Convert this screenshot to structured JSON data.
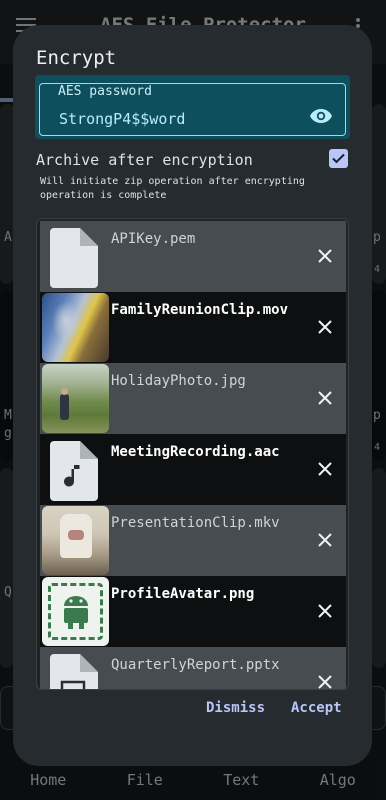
{
  "background": {
    "app_title": "AES File Protector",
    "edge_labels": [
      "A",
      "M",
      "g",
      "Q",
      "p",
      "4",
      "p",
      "4"
    ],
    "nav": [
      "Home",
      "File",
      "Text",
      "Algo"
    ]
  },
  "dialog": {
    "title": "Encrypt",
    "password": {
      "label": "AES password",
      "value": "StrongP4$$word"
    },
    "archive": {
      "label": "Archive after encryption",
      "checked": true,
      "hint": "Will initiate zip operation after encrypting operation is complete"
    },
    "files": [
      {
        "name": "APIKey.pem",
        "thumb": "doc-icon",
        "dark": false
      },
      {
        "name": "FamilyReunionClip.mov",
        "thumb": "video-thumbnail",
        "dark": true
      },
      {
        "name": "HolidayPhoto.jpg",
        "thumb": "photo-thumbnail",
        "dark": false
      },
      {
        "name": "MeetingRecording.aac",
        "thumb": "audio-icon",
        "dark": true
      },
      {
        "name": "PresentationClip.mkv",
        "thumb": "video-thumbnail",
        "dark": false
      },
      {
        "name": "ProfileAvatar.png",
        "thumb": "image-thumbnail",
        "dark": true
      },
      {
        "name": "QuarterlyReport.pptx",
        "thumb": "doc-icon",
        "dark": false
      }
    ],
    "dismiss_label": "Dismiss",
    "accept_label": "Accept"
  },
  "colors": {
    "dialog_bg": "#262b2f",
    "field_bg": "#0e4f5e",
    "accent": "#b9c6f7"
  }
}
